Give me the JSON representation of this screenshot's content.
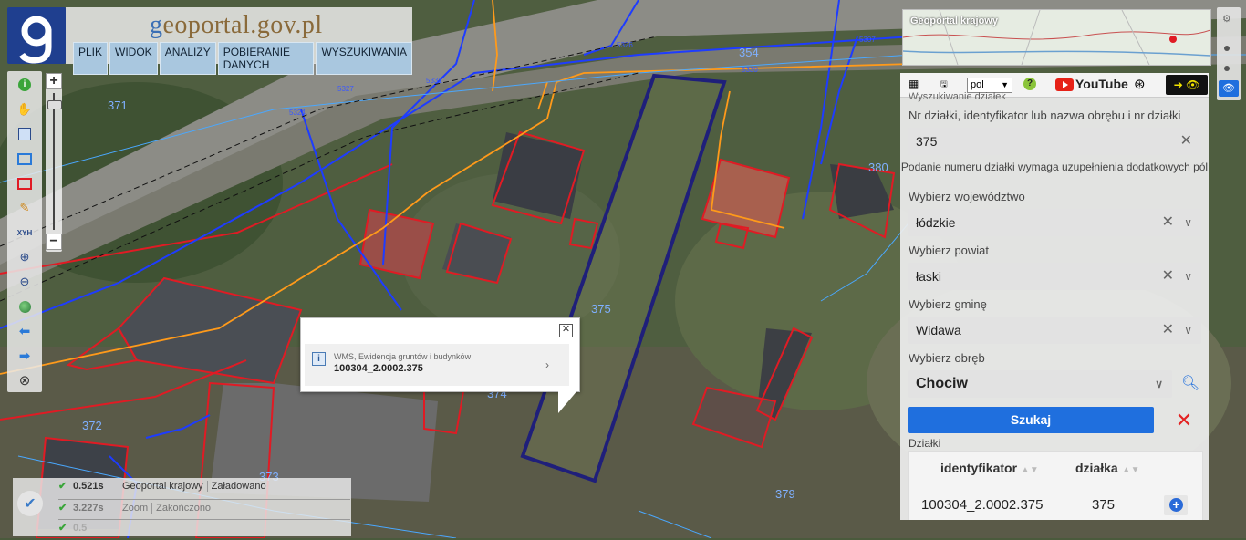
{
  "header": {
    "site_name_prefix": "g",
    "site_name_rest": "eoportal.gov.pl",
    "menu": [
      "PLIK",
      "WIDOK",
      "ANALIZY",
      "POBIERANIE DANYCH",
      "WYSZUKIWANIA"
    ]
  },
  "map": {
    "parcel_labels": [
      "371",
      "354",
      "380",
      "375",
      "374",
      "372",
      "373",
      "379"
    ],
    "small_labels": [
      "5326",
      "5307",
      "5332",
      "5327",
      "5331",
      "5324",
      "5330"
    ]
  },
  "popup": {
    "layer": "WMS, Ewidencja gruntów i budynków",
    "parcel_id": "100304_2.0002.375"
  },
  "status": {
    "rows": [
      {
        "time": "0.521s",
        "source": "Geoportal krajowy",
        "state": "Załadowano"
      },
      {
        "time": "3.227s",
        "source": "Zoom",
        "state": "Zakończono"
      },
      {
        "time": "0.5",
        "source": "",
        "state": ""
      }
    ]
  },
  "minimap": {
    "title": "Geoportal krajowy"
  },
  "panel": {
    "lang": "pol",
    "youtube_label": "YouTube",
    "section_title": "Wyszukiwanie działek",
    "parcel_label": "Nr działki, identyfikator lub nazwa obrębu i nr działki",
    "parcel_value": "375",
    "note": "Podanie numeru działki wymaga uzupełnienia dodatkowych pól",
    "voivodeship_label": "Wybierz województwo",
    "voivodeship_value": "łódzkie",
    "county_label": "Wybierz powiat",
    "county_value": "łaski",
    "commune_label": "Wybierz gminę",
    "commune_value": "Widawa",
    "precinct_label": "Wybierz obręb",
    "precinct_value": "Chociw",
    "search_button": "Szukaj",
    "results_label": "Działki",
    "table_headers": [
      "identyfikator",
      "działka"
    ],
    "table_rows": [
      {
        "id": "100304_2.0002.375",
        "parcel": "375"
      }
    ]
  },
  "colors": {
    "accent": "#1f6fde",
    "parcel_highlight": "#1f1f7a",
    "building_outline": "#e01b24",
    "cancel": "#e32222"
  }
}
